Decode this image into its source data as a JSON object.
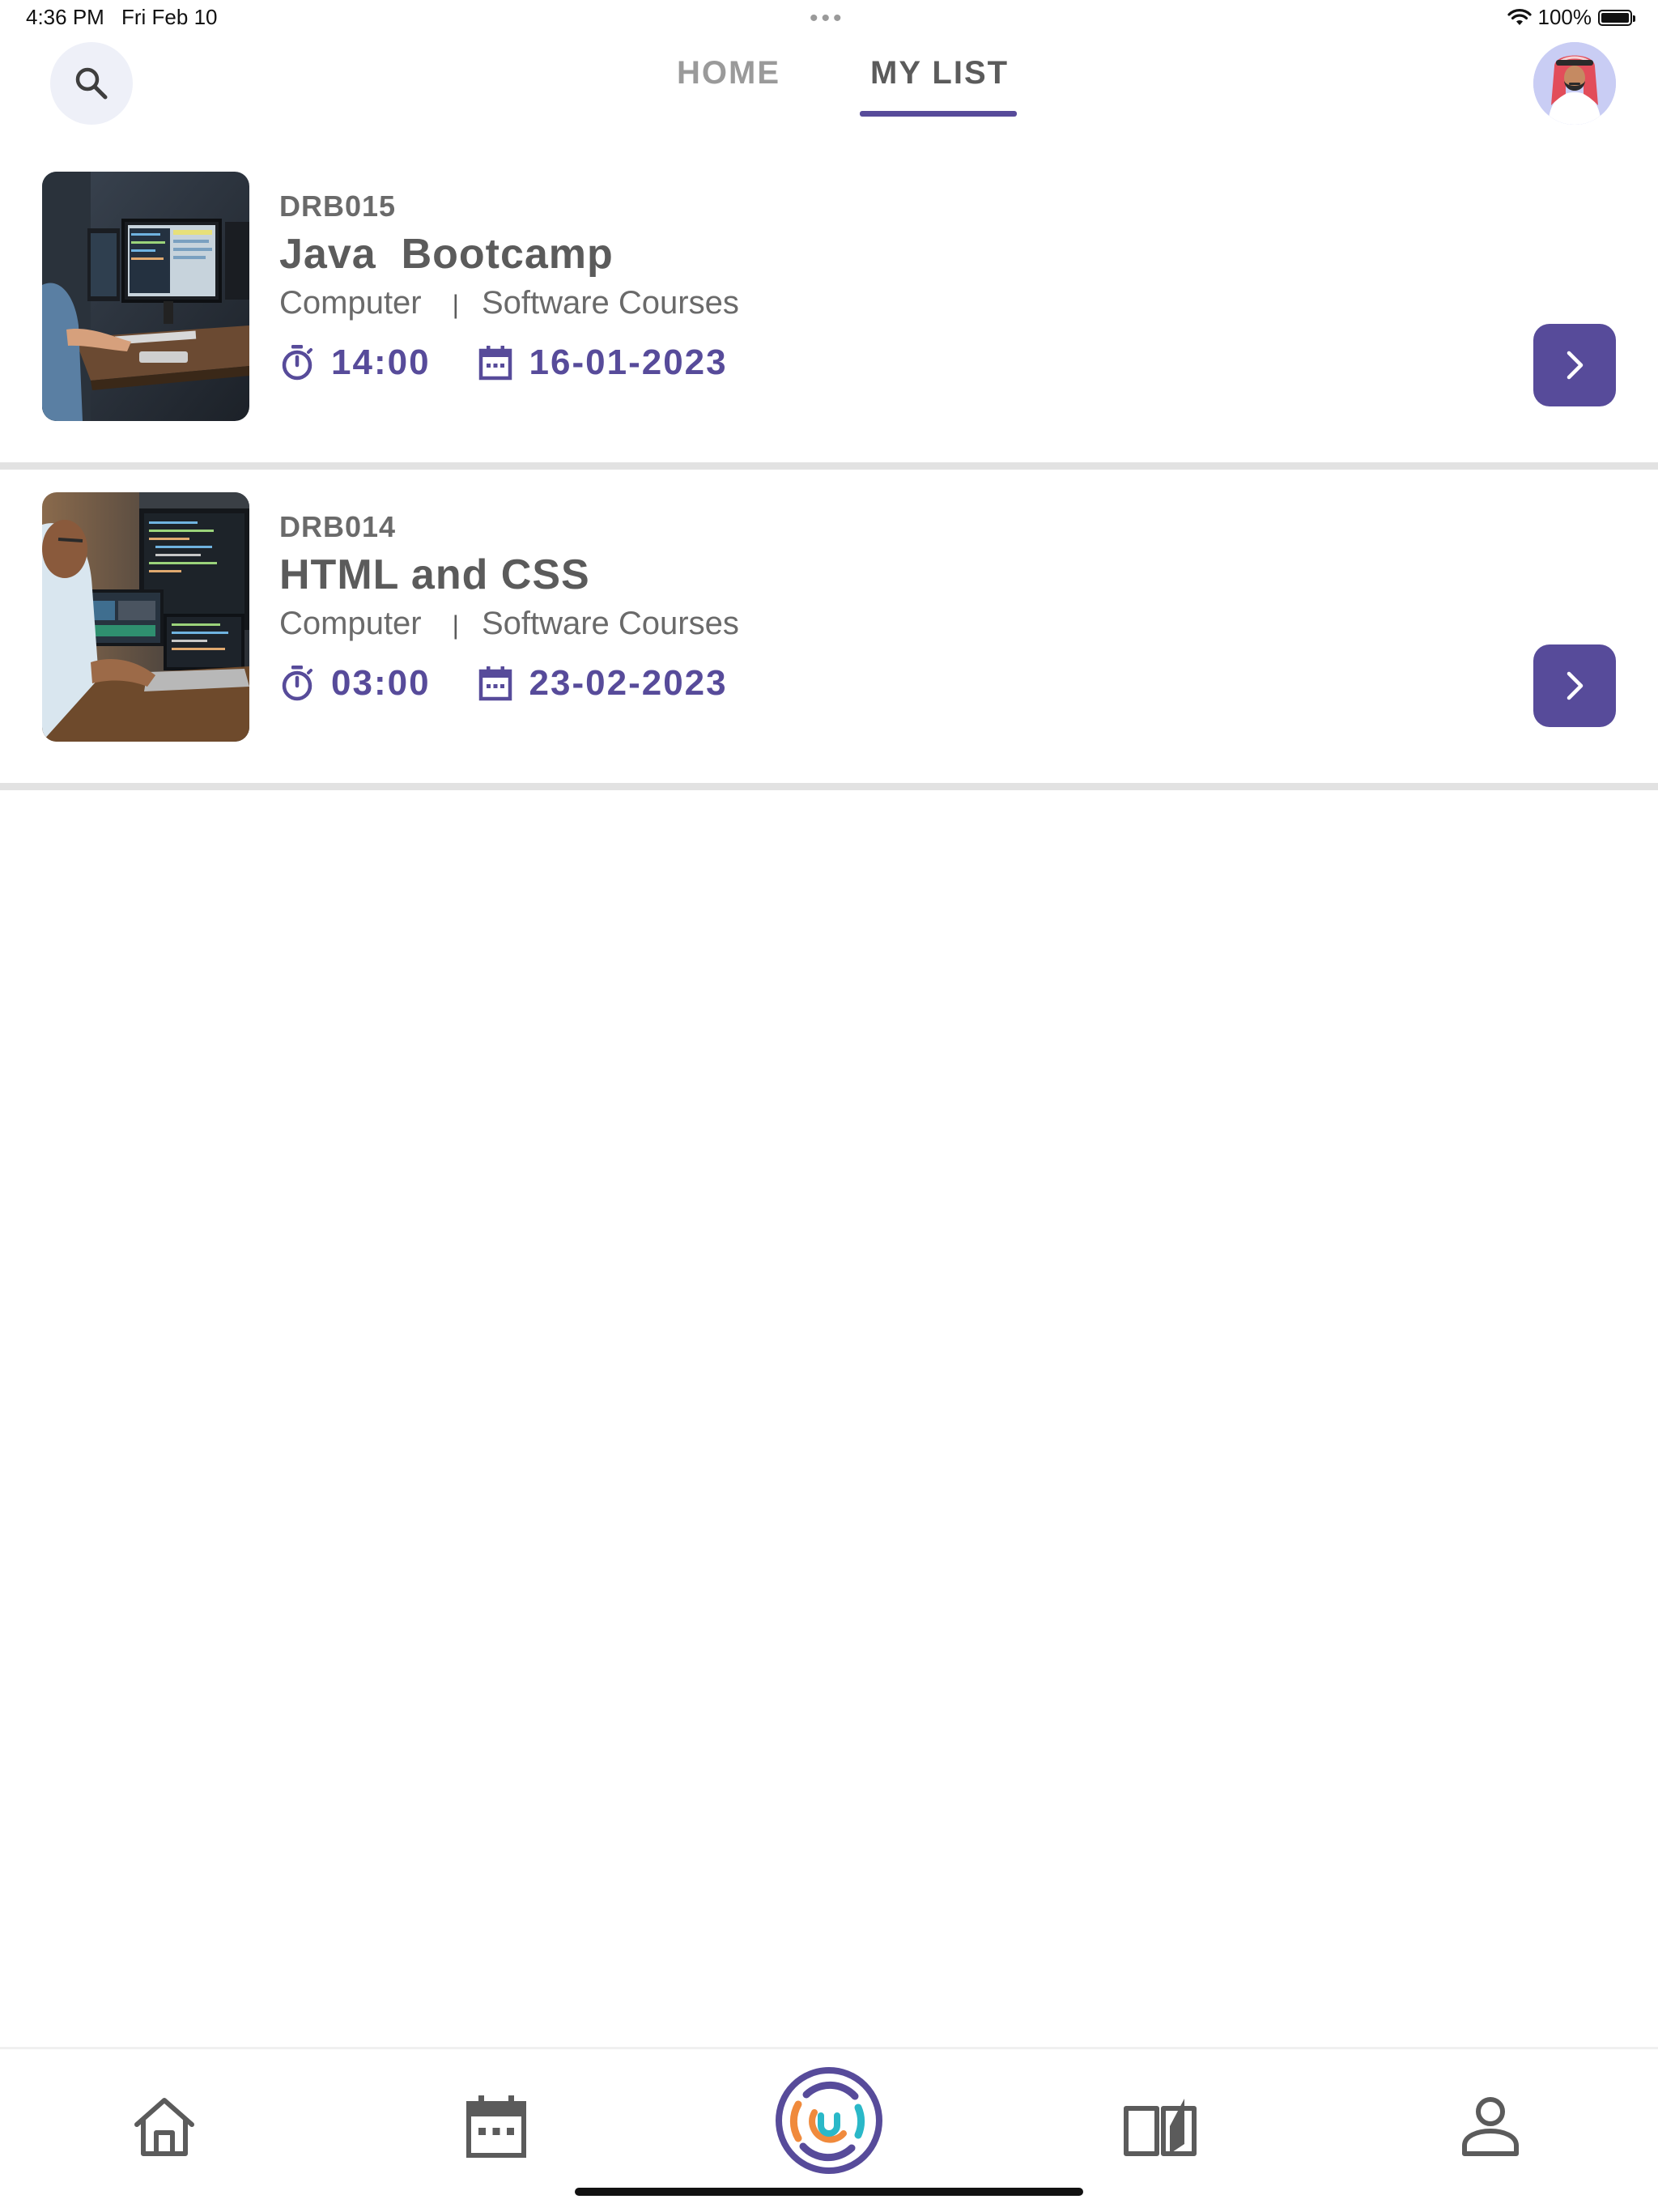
{
  "status_bar": {
    "time": "4:36 PM",
    "date": "Fri Feb 10",
    "dots": "•••",
    "battery": "100%"
  },
  "header": {
    "tabs": [
      {
        "label": "HOME",
        "active": false
      },
      {
        "label": "MY LIST",
        "active": true
      }
    ],
    "accent_color": "#574b9a"
  },
  "courses": [
    {
      "code": "DRB015",
      "title": "Java  Bootcamp",
      "category": "Computer",
      "separator": "|",
      "subcategory": "Software Courses",
      "time": "14:00",
      "date": "16-01-2023"
    },
    {
      "code": "DRB014",
      "title": "HTML and CSS",
      "category": "Computer",
      "separator": "|",
      "subcategory": "Software Courses",
      "time": "03:00",
      "date": "23-02-2023"
    }
  ],
  "icons": {
    "search": "search-icon",
    "avatar": "avatar",
    "timer": "timer-icon",
    "calendar": "calendar-icon",
    "chevron": "chevron-right-icon",
    "nav": [
      "home-icon",
      "calendar-icon",
      "app-logo-icon",
      "library-icon",
      "profile-icon"
    ]
  }
}
